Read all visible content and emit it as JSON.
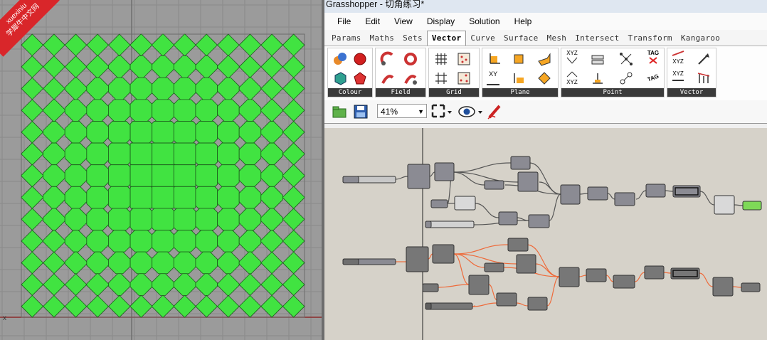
{
  "watermark": {
    "line1": "xuexiniu",
    "line2": "学犀牛中文网"
  },
  "viewport": {
    "axis_label": "x"
  },
  "window": {
    "title": "Grasshopper - 切角练习*"
  },
  "menu": [
    "File",
    "Edit",
    "View",
    "Display",
    "Solution",
    "Help"
  ],
  "tabs": [
    {
      "label": "Params",
      "active": false
    },
    {
      "label": "Maths",
      "active": false
    },
    {
      "label": "Sets",
      "active": false
    },
    {
      "label": "Vector",
      "active": true
    },
    {
      "label": "Curve",
      "active": false
    },
    {
      "label": "Surface",
      "active": false
    },
    {
      "label": "Mesh",
      "active": false
    },
    {
      "label": "Intersect",
      "active": false
    },
    {
      "label": "Transform",
      "active": false
    },
    {
      "label": "Kangaroo",
      "active": false
    }
  ],
  "ribbon": {
    "colour": "Colour",
    "field": "Field",
    "grid": "Grid",
    "plane": "Plane",
    "point": "Point",
    "vector": "Vector",
    "xyz": "XYZ",
    "xy": "XY",
    "tag": "TAG"
  },
  "toolbar": {
    "zoom": "41%"
  },
  "colors": {
    "tile": "#41e341",
    "accent_node": "#7ed957",
    "wire_orange": "#ee6a3a",
    "wire_grey": "#555555"
  }
}
